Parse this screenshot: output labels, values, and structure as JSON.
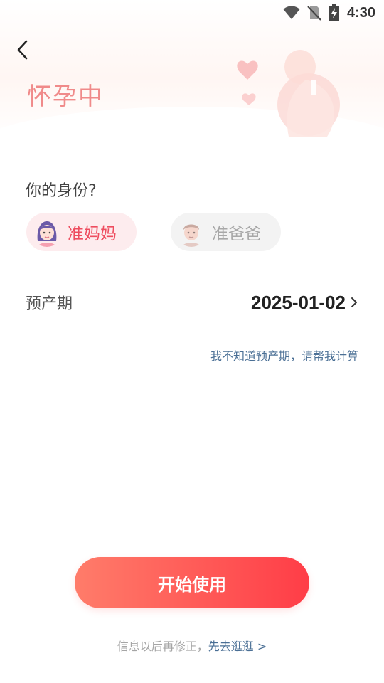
{
  "status_bar": {
    "time": "4:30",
    "icons": [
      "wifi-icon",
      "no-sim-icon",
      "battery-charging-icon"
    ]
  },
  "header": {
    "title": "怀孕中"
  },
  "identity": {
    "question": "你的身份?",
    "options": [
      {
        "label": "准妈妈",
        "selected": true
      },
      {
        "label": "准爸爸",
        "selected": false
      }
    ]
  },
  "due_date": {
    "label": "预产期",
    "value": "2025-01-02"
  },
  "calc_link": "我不知道预产期，请帮我计算",
  "start_button": "开始使用",
  "footer": {
    "note": "信息以后再修正，",
    "browse": "先去逛逛 >"
  },
  "colors": {
    "title": "#f08a8a",
    "accent_start": "#ff7c6a",
    "accent_end": "#ff3d47",
    "selected_bg": "#fdecee",
    "selected_text": "#ee4d5f",
    "link": "#4a6f95"
  }
}
